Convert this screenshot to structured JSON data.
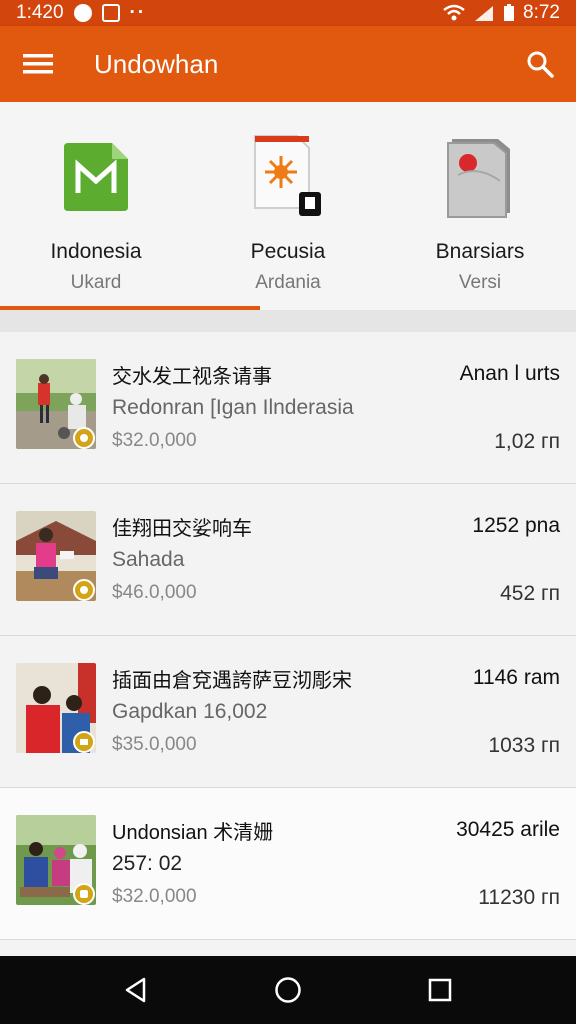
{
  "status_bar": {
    "time": "1:420",
    "right_text": "8:72",
    "icons": [
      "notification-dot-icon",
      "app-icon",
      "overflow-dots-icon",
      "wifi-icon",
      "signal-icon",
      "battery-icon"
    ]
  },
  "app_bar": {
    "title": "Undowhan",
    "background": "#e0590f",
    "menu_icon": "hamburger-menu-icon",
    "search_icon": "search-icon"
  },
  "tabs": [
    {
      "title": "Indonesia",
      "subtitle": "Ukard",
      "icon": "green-document-icon",
      "selected": true
    },
    {
      "title": "Pecusia",
      "subtitle": "Ardania",
      "icon": "orange-sun-document-icon",
      "selected": false
    },
    {
      "title": "Bnarsiars",
      "subtitle": "Versi",
      "icon": "red-folder-icon",
      "selected": false
    }
  ],
  "listings": [
    {
      "title": "交水发工视条请事",
      "subtitle": "Redonran [Igan Ilnderasia",
      "price": "$32.0,000",
      "right_top": "Anan l urts",
      "right_bottom": "1,02 гп"
    },
    {
      "title": "佳翔田交娑响车",
      "subtitle": "Sahada",
      "price": "$46.0,000",
      "right_top": "1252 pna",
      "right_bottom": "452 гп"
    },
    {
      "title": "插面由倉兗遇誇萨豆沏彫宋",
      "subtitle": "Gapdkan 16,002",
      "price": "$35.0,000",
      "right_top": "1146 ram",
      "right_bottom": "1033 гп"
    },
    {
      "title": "Undonsian 术清姗",
      "subtitle": "257: 02",
      "price": "$32.0,000",
      "right_top": "30425 arile",
      "right_bottom": "11230 гп"
    }
  ],
  "nav_bar": {
    "buttons": [
      "back-icon",
      "home-icon",
      "recents-icon"
    ]
  }
}
